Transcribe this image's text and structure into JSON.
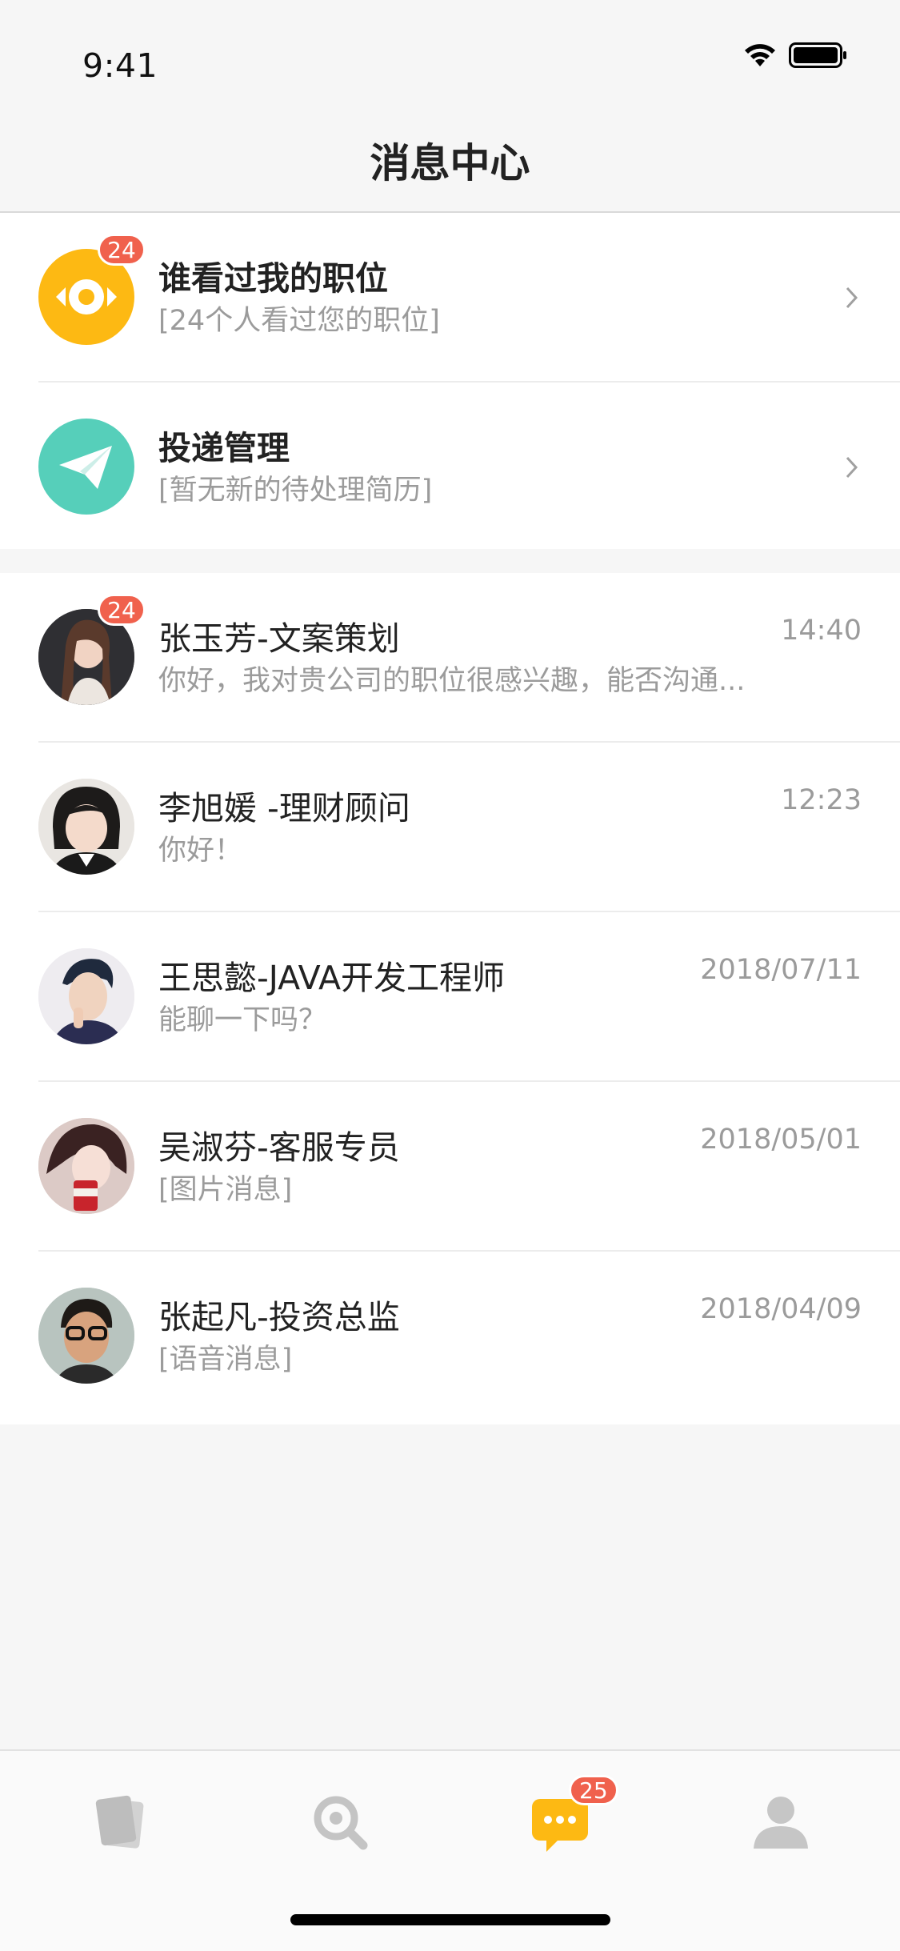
{
  "status_bar": {
    "time": "9:41"
  },
  "nav": {
    "title": "消息中心"
  },
  "system_items": [
    {
      "title": "谁看过我的职位",
      "subtitle": "[24个人看过您的职位]",
      "badge": "24",
      "icon": "eye-icon",
      "color": "#fdb913"
    },
    {
      "title": "投递管理",
      "subtitle": "[暂无新的待处理简历]",
      "icon": "paper-plane-icon",
      "color": "#56cfba"
    }
  ],
  "messages": [
    {
      "name": "张玉芳-文案策划",
      "preview": "你好，我对贵公司的职位很感兴趣，能否沟通...",
      "time": "14:40",
      "badge": "24"
    },
    {
      "name": "李旭媛 -理财顾问",
      "preview": "你好！",
      "time": "12:23"
    },
    {
      "name": "王思懿-JAVA开发工程师",
      "preview": "能聊一下吗？",
      "time": "2018/07/11"
    },
    {
      "name": "吴淑芬-客服专员",
      "preview": "[图片消息]",
      "time": "2018/05/01"
    },
    {
      "name": "张起凡-投资总监",
      "preview": "[语音消息]",
      "time": "2018/04/09"
    }
  ],
  "tab_bar": {
    "tabs": [
      {
        "icon": "cards-icon"
      },
      {
        "icon": "search-icon"
      },
      {
        "icon": "chat-icon",
        "badge": "25",
        "active": true
      },
      {
        "icon": "profile-icon"
      }
    ],
    "active_color": "#fdb913",
    "inactive_color": "#c9c9c9"
  }
}
